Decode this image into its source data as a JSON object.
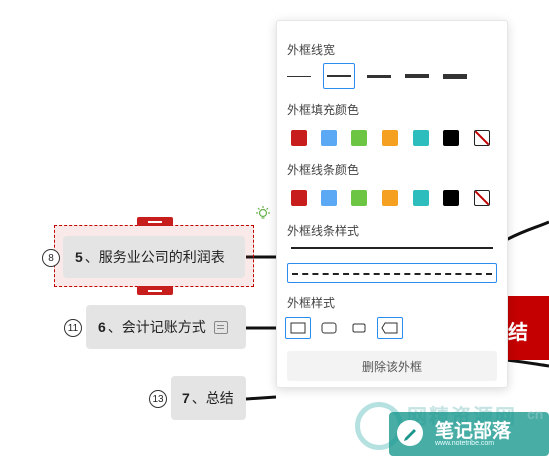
{
  "mindmap": {
    "nodes": [
      {
        "index": "8",
        "num": "5",
        "sep": "、",
        "label": "服务业公司的利润表"
      },
      {
        "index": "11",
        "num": "6",
        "sep": "、",
        "label": "会计记账方式"
      },
      {
        "index": "13",
        "num": "7",
        "sep": "、",
        "label": "总结"
      }
    ],
    "red_block_text": "结"
  },
  "panel": {
    "border_width_title": "外框线宽",
    "fill_color_title": "外框填充颜色",
    "line_color_title": "外框线条颜色",
    "line_style_title": "外框线条样式",
    "shape_title": "外框样式",
    "delete_label": "删除该外框",
    "colors": [
      "#c81d1d",
      "#5ba8f5",
      "#6cc644",
      "#f5a020",
      "#2ebdbd",
      "#000000"
    ]
  },
  "watermark": {
    "text": "笔记部落",
    "url": "www.notetribe.com",
    "faint": "网精资源网",
    "faint_url": "cn"
  }
}
